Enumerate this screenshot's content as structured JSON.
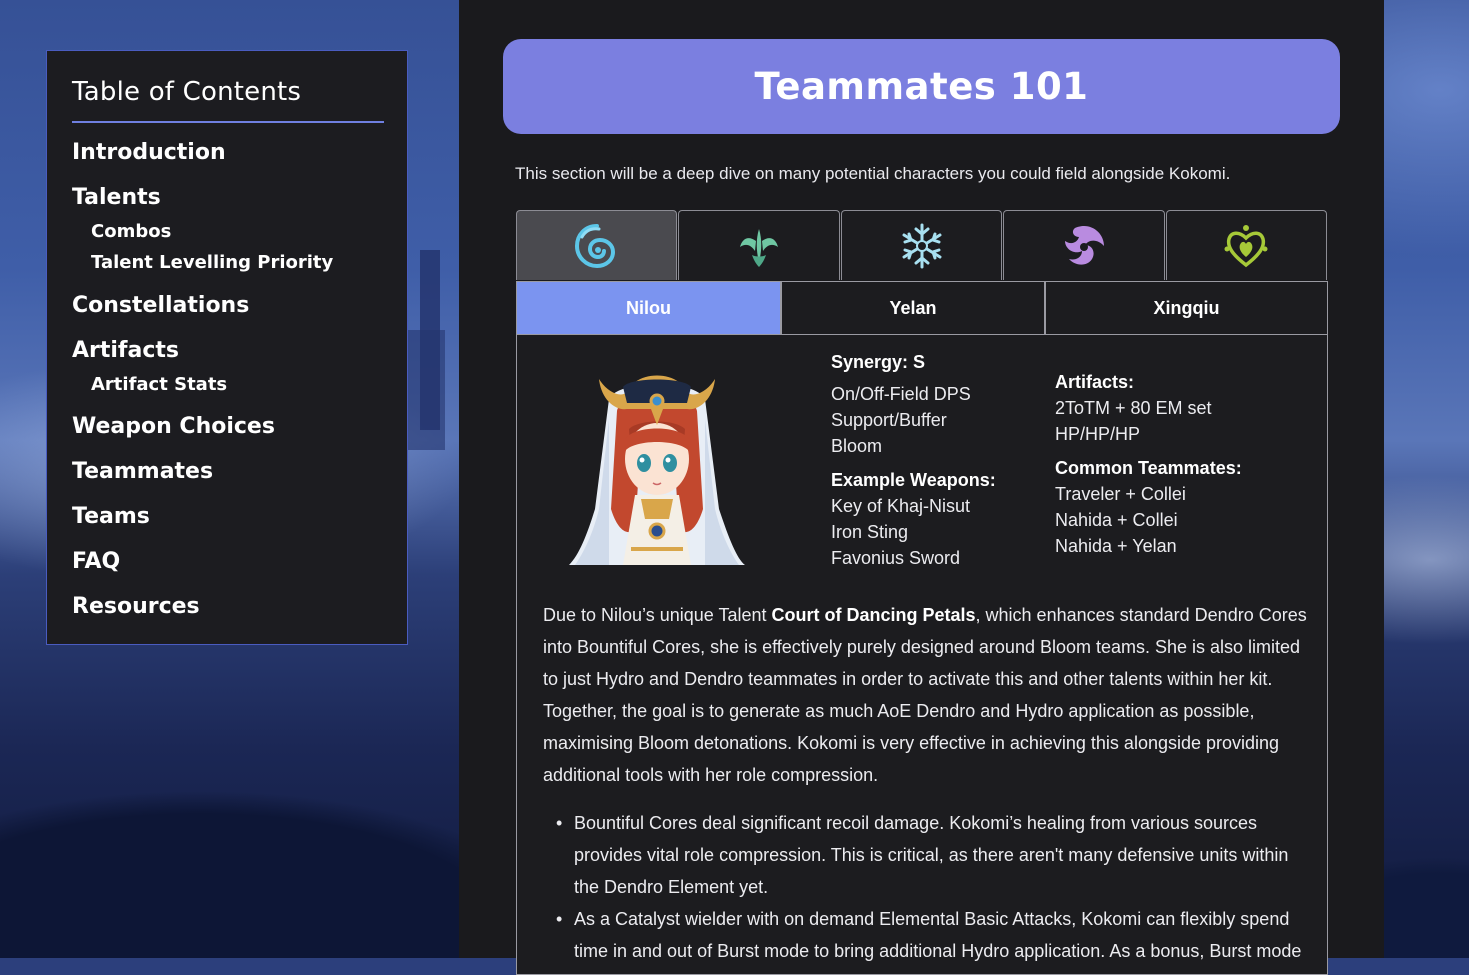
{
  "toc": {
    "title": "Table of Contents",
    "items": [
      {
        "label": "Introduction"
      },
      {
        "label": "Talents"
      },
      {
        "label": "Combos"
      },
      {
        "label": "Talent Levelling Priority"
      },
      {
        "label": "Constellations"
      },
      {
        "label": "Artifacts"
      },
      {
        "label": "Artifact Stats"
      },
      {
        "label": "Weapon Choices"
      },
      {
        "label": "Teammates"
      },
      {
        "label": "Teams"
      },
      {
        "label": "FAQ"
      },
      {
        "label": "Resources"
      }
    ]
  },
  "section": {
    "title": "Teammates 101",
    "intro": "This section will be a deep dive on many potential characters you could field alongside Kokomi."
  },
  "element_tabs": [
    {
      "icon": "hydro-icon",
      "color": "#5cc6e8",
      "active": true
    },
    {
      "icon": "anemo-icon",
      "color": "#6fc7a3",
      "active": false
    },
    {
      "icon": "cryo-icon",
      "color": "#a8e0f0",
      "active": false
    },
    {
      "icon": "electro-icon",
      "color": "#b98be0",
      "active": false
    },
    {
      "icon": "dendro-icon",
      "color": "#a6c938",
      "active": false
    }
  ],
  "character_tabs": [
    {
      "label": "Nilou",
      "active": true
    },
    {
      "label": "Yelan",
      "active": false
    },
    {
      "label": "Xingqiu",
      "active": false
    }
  ],
  "character": {
    "synergy_label": "Synergy: S",
    "roles": [
      "On/Off-Field DPS",
      "Support/Buffer",
      "Bloom"
    ],
    "weapons_label": "Example Weapons:",
    "weapons": [
      "Key of Khaj-Nisut",
      "Iron Sting",
      "Favonius Sword"
    ],
    "artifacts_label": "Artifacts:",
    "artifacts": [
      "2ToTM + 80 EM set",
      "HP/HP/HP"
    ],
    "teammates_label": "Common Teammates:",
    "teammates": [
      "Traveler + Collei",
      "Nahida + Collei",
      "Nahida + Yelan"
    ]
  },
  "body": {
    "p1_before": "Due to Nilou’s unique Talent ",
    "p1_bold": "Court of Dancing Petals",
    "p1_after": ", which enhances standard Dendro Cores into Bountiful Cores, she is effectively purely designed around Bloom teams. She is also limited to just Hydro and Dendro teammates in order to activate this and other talents within her kit. Together, the goal is to generate as much AoE Dendro and Hydro application as possible, maximising Bloom detonations. Kokomi is very effective in achieving this alongside providing additional tools with her role compression.",
    "bullets": [
      "Bountiful Cores deal significant recoil damage. Kokomi’s healing from various sources provides vital role compression. This is critical, as there aren't many defensive units within the Dendro Element yet.",
      "As a Catalyst wielder with on demand Elemental Basic Attacks, Kokomi can flexibly spend time in and out of Burst mode to bring additional Hydro application. As a bonus, Burst mode"
    ]
  }
}
